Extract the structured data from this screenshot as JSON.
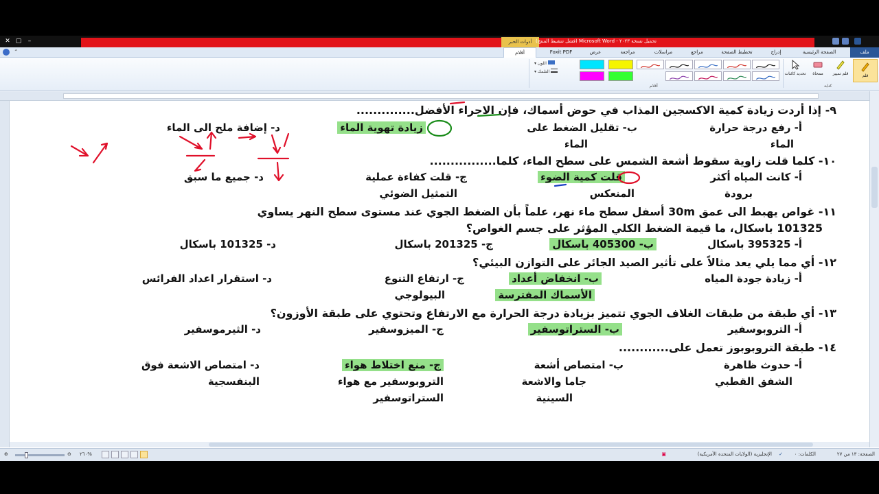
{
  "window": {
    "title": "تحميل نسخة ٢٠٢٣ - Microsoft Word (فشل تنشيط المنتج)",
    "contextual_tab": "أدوات الحبر"
  },
  "tabs": [
    "ملف",
    "الصفحة الرئيسية",
    "إدراج",
    "تخطيط الصفحة",
    "مراجع",
    "مراسلات",
    "مراجعة",
    "عرض",
    "Foxit PDF",
    "أقلام"
  ],
  "ribbon": {
    "pen_label": "قلم",
    "highlighter_label": "قلم تمييز",
    "eraser_label": "ممحاة",
    "select_label": "تحديد كائنات",
    "writing_group": "كتابة",
    "pens_group": "أقلام",
    "color_label": "اللون",
    "thickness_label": "السُمك",
    "pen_colors": [
      "#1a1a1a",
      "#d0342c",
      "#3a6fc4",
      "#1a1a1a",
      "#d0342c",
      "#3a6fc4",
      "#2e8b57",
      "#c2185b",
      "#8e44ad"
    ],
    "highlighter_colors": [
      "#00e5ff",
      "#f5f500",
      "#ff00ff",
      "#33ff33"
    ]
  },
  "questions": [
    {
      "stem": "٩- إذا أردت زيادة كمية الاكسجين المذاب في حوض أسماك، فإن الاجراء الأفضل..............",
      "a": "أ- رفع درجة حرارة",
      "a2": "الماء",
      "b": "ب- تقليل الضغط على",
      "b2": "الماء",
      "c": "زيادة تهوية الماء",
      "d": "د- إضافة ملح الى الماء"
    },
    {
      "stem": "١٠- كلما قلت زاوية سقوط أشعة الشمس على سطح الماء، كلما................",
      "a": "أ- كانت المياه أكثر",
      "a2": "برودة",
      "b": "قلت كمية الضوء",
      "b2": "المنعكس",
      "c": "ج- قلت كفاءة عملية",
      "c2": "التمثيل الضوئي",
      "d": "د- جميع ما سبق"
    },
    {
      "stem": "١١- غواص يهبط الى عمق 30m أسفل سطح ماء نهر، علماً بأن الضغط الجوي عند مستوى سطح النهر يساوي",
      "stem2": "101325 باسكال، ما قيمة الضغط الكلي المؤثر على جسم الغواص؟",
      "a": "أ- 395325 باسكال",
      "b": "ب- 405300 باسكال",
      "c": "ج- 201325 باسكال",
      "d": "د- 101325 باسكال"
    },
    {
      "stem": "١٢- أي مما يلي يعد مثالاً على تأثير الصيد الجائر على التوازن البيئي؟",
      "a": "أ- زيادة جودة المياه",
      "b": "ب- انخفاض أعداد",
      "b2": "الأسماك المفترسة",
      "c": "ج- ارتفاع التنوع",
      "c2": "البيولوجي",
      "d": "د- استقرار اعداد الفرائس"
    },
    {
      "stem": "١٣- أي طبقة من طبقات الغلاف الجوي تتميز بزيادة درجة الحرارة مع الارتفاع وتحتوي على طبقة الأوزون؟",
      "a": "أ- التروبوسفير",
      "b": "ب- الستراتوسفير",
      "c": "ج- الميزوسفير",
      "d": "د- الثيرموسفير"
    },
    {
      "stem": "١٤- طبقة التروبوبوز تعمل على............",
      "a": "أ- حدوث ظاهرة",
      "a2": "الشفق القطبي",
      "b": "ب- امتصاص أشعة",
      "b2": "جاما والاشعة",
      "b3": "السينية",
      "c": "ج- منع اختلاط هواء",
      "c2": "التروبوسفير مع هواء",
      "c3": "الستراتوسفير",
      "d": "د- امتصاص الاشعة فوق",
      "d2": "البنفسجية"
    }
  ],
  "status": {
    "page": "الصفحة: ١٣ من ٢٧",
    "words": "الكلمات: ٠",
    "language": "الإنجليزية (الولايات المتحدة الأمريكية)",
    "zoom": "٢٦٠%"
  }
}
